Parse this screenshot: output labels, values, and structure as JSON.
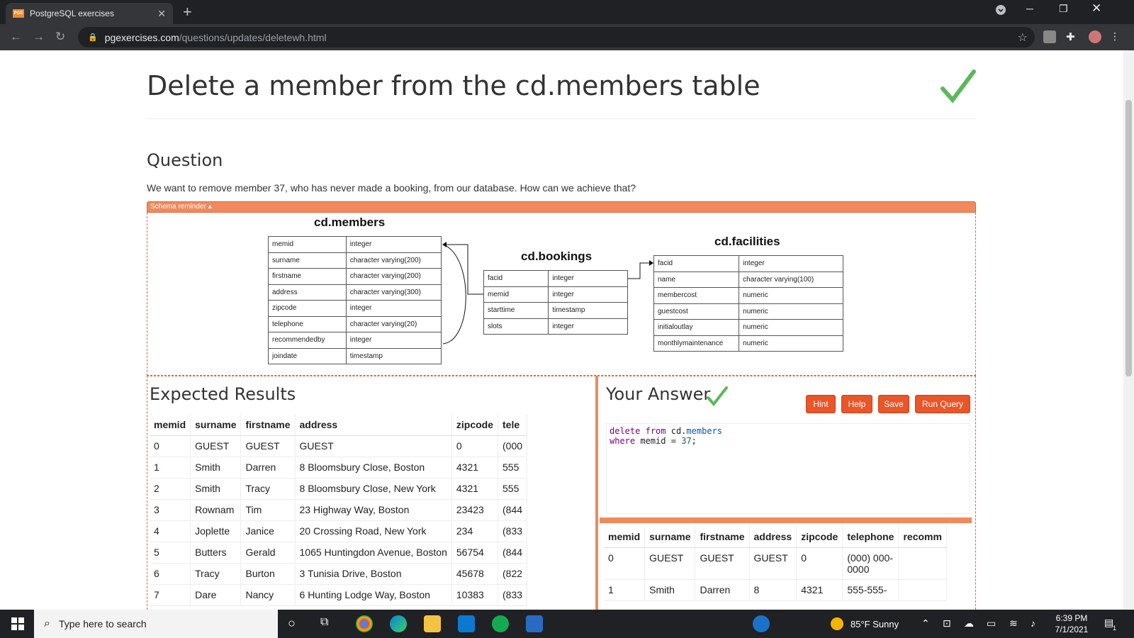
{
  "browser": {
    "tab_title": "PostgreSQL exercises",
    "tab_favicon": "PGE",
    "url_domain": "pgexercises.com",
    "url_path": "/questions/updates/deletewh.html"
  },
  "page": {
    "title": "Delete a member from the cd.members table",
    "question_heading": "Question",
    "question_text": "We want to remove member 37, who has never made a booking, from our database. How can we achieve that?",
    "schema_label": "Schema reminder ▴",
    "expected_heading": "Expected Results",
    "answer_heading": "Your Answer",
    "buttons": {
      "hint": "Hint",
      "help": "Help",
      "save": "Save",
      "run": "Run Query"
    },
    "answer_code": {
      "l1_kw1": "delete",
      "l1_kw2": "from",
      "l1_schema": "cd.",
      "l1_table": "members",
      "l2_kw": "where",
      "l2_col": "memid",
      "l2_op": "=",
      "l2_num": "37",
      "l2_end": ";"
    }
  },
  "schema": {
    "members": {
      "title": "cd.members",
      "rows": [
        [
          "memid",
          "integer"
        ],
        [
          "surname",
          "character varying(200)"
        ],
        [
          "firstname",
          "character varying(200)"
        ],
        [
          "address",
          "character varying(300)"
        ],
        [
          "zipcode",
          "integer"
        ],
        [
          "telephone",
          "character varying(20)"
        ],
        [
          "recommendedby",
          "integer"
        ],
        [
          "joindate",
          "timestamp"
        ]
      ]
    },
    "bookings": {
      "title": "cd.bookings",
      "rows": [
        [
          "facid",
          "integer"
        ],
        [
          "memid",
          "integer"
        ],
        [
          "starttime",
          "timestamp"
        ],
        [
          "slots",
          "integer"
        ]
      ]
    },
    "facilities": {
      "title": "cd.facilities",
      "rows": [
        [
          "facid",
          "integer"
        ],
        [
          "name",
          "character varying(100)"
        ],
        [
          "membercost",
          "numeric"
        ],
        [
          "guestcost",
          "numeric"
        ],
        [
          "initialoutlay",
          "numeric"
        ],
        [
          "monthlymaintenance",
          "numeric"
        ]
      ]
    }
  },
  "expected": {
    "headers": [
      "memid",
      "surname",
      "firstname",
      "address",
      "zipcode",
      "tele"
    ],
    "rows": [
      [
        "0",
        "GUEST",
        "GUEST",
        "GUEST",
        "0",
        "(000"
      ],
      [
        "1",
        "Smith",
        "Darren",
        "8 Bloomsbury Close, Boston",
        "4321",
        "555"
      ],
      [
        "2",
        "Smith",
        "Tracy",
        "8 Bloomsbury Close, New York",
        "4321",
        "555"
      ],
      [
        "3",
        "Rownam",
        "Tim",
        "23 Highway Way, Boston",
        "23423",
        "(844"
      ],
      [
        "4",
        "Joplette",
        "Janice",
        "20 Crossing Road, New York",
        "234",
        "(833"
      ],
      [
        "5",
        "Butters",
        "Gerald",
        "1065 Huntingdon Avenue, Boston",
        "56754",
        "(844"
      ],
      [
        "6",
        "Tracy",
        "Burton",
        "3 Tunisia Drive, Boston",
        "45678",
        "(822"
      ],
      [
        "7",
        "Dare",
        "Nancy",
        "6 Hunting Lodge Way, Boston",
        "10383",
        "(833"
      ]
    ]
  },
  "answer_results": {
    "headers": [
      "memid",
      "surname",
      "firstname",
      "address",
      "zipcode",
      "telephone",
      "recomm"
    ],
    "rows": [
      [
        "0",
        "GUEST",
        "GUEST",
        "GUEST",
        "0",
        "(000) 000-\n0000",
        ""
      ],
      [
        "1",
        "Smith",
        "Darren",
        "8",
        "4321",
        "555-555-",
        ""
      ]
    ]
  },
  "taskbar": {
    "search_placeholder": "Type here to search",
    "weather": "85°F  Sunny",
    "time": "6:39 PM",
    "date": "7/1/2021",
    "notifications": "1"
  },
  "colors": {
    "accent": "#e8562a",
    "schema_bar": "#f08a5d",
    "check": "#5cb85c"
  },
  "icons": [
    "chrome-icon",
    "edge-icon",
    "file-explorer-icon",
    "vscode-icon",
    "mongodb-icon",
    "photos-icon"
  ]
}
